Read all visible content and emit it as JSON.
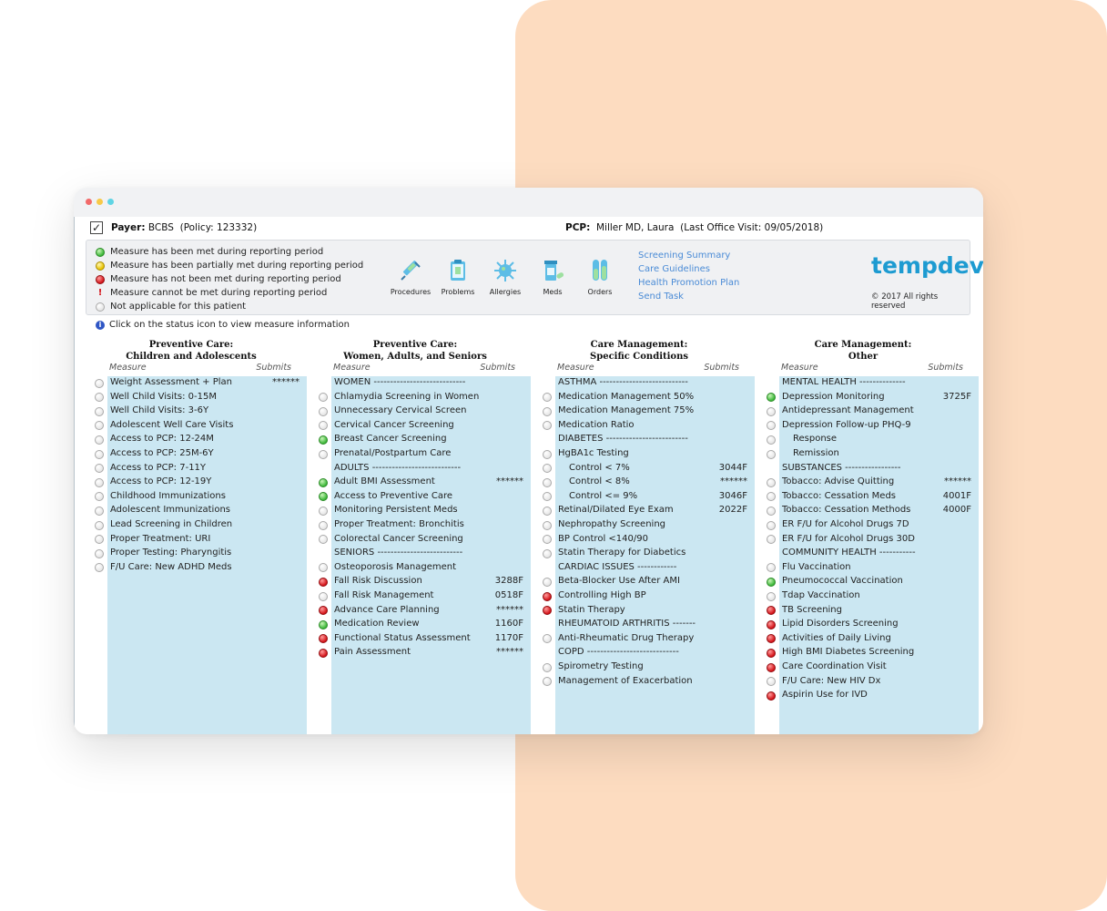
{
  "header": {
    "payer_label": "Payer:",
    "payer_value": "BCBS",
    "policy": "(Policy: 123332)",
    "pcp_label": "PCP:",
    "pcp_value": "Miller MD, Laura",
    "last_visit": "(Last Office Visit: 09/05/2018)"
  },
  "legend": [
    {
      "status": "met",
      "text": "Measure has been met during reporting period"
    },
    {
      "status": "partial",
      "text": "Measure has been partially met during reporting period"
    },
    {
      "status": "notmet",
      "text": "Measure has not been met during reporting period"
    },
    {
      "status": "cannot",
      "text": "Measure cannot be met during reporting period"
    },
    {
      "status": "na",
      "text": "Not applicable for this patient"
    }
  ],
  "tools": [
    {
      "label": "Procedures",
      "icon": "syringe-icon"
    },
    {
      "label": "Problems",
      "icon": "clipboard-icon"
    },
    {
      "label": "Allergies",
      "icon": "virus-icon"
    },
    {
      "label": "Meds",
      "icon": "pill-bottle-icon"
    },
    {
      "label": "Orders",
      "icon": "test-tubes-icon"
    }
  ],
  "links": [
    "Screening Summary",
    "Care Guidelines",
    "Health Promotion Plan",
    "Send Task"
  ],
  "brand": {
    "name": "tempdev",
    "copyright": "© 2017 All rights reserved"
  },
  "hint": "Click on the status icon to view measure information",
  "columns_header": {
    "measure": "Measure",
    "submits": "Submits"
  },
  "colors": {
    "accent_list": "#cbe7f2",
    "link": "#4a8bd6",
    "brand": "#1d9bd1",
    "peach": "#fddcc0"
  },
  "columns": [
    {
      "title1": "Preventive Care:",
      "title2": "Children and Adolescents",
      "rows": [
        {
          "status": "n",
          "label": "Weight Assessment + Plan",
          "submits": "******"
        },
        {
          "status": "n",
          "label": "Well Child Visits: 0-15M",
          "submits": ""
        },
        {
          "status": "n",
          "label": "Well Child Visits: 3-6Y",
          "submits": ""
        },
        {
          "status": "n",
          "label": "Adolescent Well Care Visits",
          "submits": ""
        },
        {
          "status": "n",
          "label": "Access to PCP: 12-24M",
          "submits": ""
        },
        {
          "status": "n",
          "label": "Access to PCP: 25M-6Y",
          "submits": ""
        },
        {
          "status": "n",
          "label": "Access to PCP: 7-11Y",
          "submits": ""
        },
        {
          "status": "n",
          "label": "Access to PCP: 12-19Y",
          "submits": ""
        },
        {
          "status": "n",
          "label": "Childhood Immunizations",
          "submits": ""
        },
        {
          "status": "n",
          "label": "Adolescent Immunizations",
          "submits": ""
        },
        {
          "status": "n",
          "label": "Lead Screening in Children",
          "submits": ""
        },
        {
          "status": "n",
          "label": "Proper Treatment: URI",
          "submits": ""
        },
        {
          "status": "n",
          "label": "Proper Testing: Pharyngitis",
          "submits": ""
        },
        {
          "status": "n",
          "label": "F/U Care: New ADHD Meds",
          "submits": ""
        }
      ]
    },
    {
      "title1": "Preventive Care:",
      "title2": "Women, Adults, and Seniors",
      "rows": [
        {
          "status": "",
          "label": "WOMEN ----------------------------",
          "submits": ""
        },
        {
          "status": "n",
          "label": "Chlamydia Screening in Women",
          "submits": ""
        },
        {
          "status": "n",
          "label": "Unnecessary Cervical Screen",
          "submits": ""
        },
        {
          "status": "n",
          "label": "Cervical Cancer Screening",
          "submits": ""
        },
        {
          "status": "g",
          "label": "Breast Cancer Screening",
          "submits": ""
        },
        {
          "status": "n",
          "label": "Prenatal/Postpartum Care",
          "submits": ""
        },
        {
          "status": "",
          "label": "ADULTS ---------------------------",
          "submits": ""
        },
        {
          "status": "g",
          "label": "Adult BMI Assessment",
          "submits": "******"
        },
        {
          "status": "g",
          "label": "Access to Preventive Care",
          "submits": ""
        },
        {
          "status": "n",
          "label": "Monitoring Persistent Meds",
          "submits": ""
        },
        {
          "status": "n",
          "label": "Proper Treatment: Bronchitis",
          "submits": ""
        },
        {
          "status": "n",
          "label": "Colorectal Cancer Screening",
          "submits": ""
        },
        {
          "status": "",
          "label": "SENIORS --------------------------",
          "submits": ""
        },
        {
          "status": "n",
          "label": "Osteoporosis Management",
          "submits": ""
        },
        {
          "status": "r",
          "label": "Fall Risk Discussion",
          "submits": "3288F"
        },
        {
          "status": "n",
          "label": "Fall Risk Management",
          "submits": "0518F"
        },
        {
          "status": "r",
          "label": "Advance Care Planning",
          "submits": "******"
        },
        {
          "status": "g",
          "label": "Medication Review",
          "submits": "1160F"
        },
        {
          "status": "r",
          "label": "Functional Status Assessment",
          "submits": "1170F"
        },
        {
          "status": "r",
          "label": "Pain Assessment",
          "submits": "******"
        }
      ]
    },
    {
      "title1": "Care Management:",
      "title2": "Specific Conditions",
      "rows": [
        {
          "status": "",
          "label": "ASTHMA ---------------------------",
          "submits": ""
        },
        {
          "status": "n",
          "label": "Medication Management 50%",
          "submits": ""
        },
        {
          "status": "n",
          "label": "Medication Management 75%",
          "submits": ""
        },
        {
          "status": "n",
          "label": "Medication Ratio",
          "submits": ""
        },
        {
          "status": "",
          "label": "DIABETES -------------------------",
          "submits": ""
        },
        {
          "status": "n",
          "label": "HgBA1c Testing",
          "submits": ""
        },
        {
          "status": "n",
          "label": "Control < 7%",
          "submits": "3044F",
          "indent": true
        },
        {
          "status": "n",
          "label": "Control < 8%",
          "submits": "******",
          "indent": true
        },
        {
          "status": "n",
          "label": "Control <= 9%",
          "submits": "3046F",
          "indent": true
        },
        {
          "status": "n",
          "label": "Retinal/Dilated Eye Exam",
          "submits": "2022F"
        },
        {
          "status": "n",
          "label": "Nephropathy Screening",
          "submits": ""
        },
        {
          "status": "n",
          "label": "BP Control <140/90",
          "submits": ""
        },
        {
          "status": "n",
          "label": "Statin Therapy for Diabetics",
          "submits": ""
        },
        {
          "status": "",
          "label": "CARDIAC ISSUES ------------",
          "submits": ""
        },
        {
          "status": "n",
          "label": "Beta-Blocker Use After AMI",
          "submits": ""
        },
        {
          "status": "r",
          "label": "Controlling High BP",
          "submits": ""
        },
        {
          "status": "r",
          "label": "Statin Therapy",
          "submits": ""
        },
        {
          "status": "",
          "label": "RHEUMATOID ARTHRITIS -------",
          "submits": ""
        },
        {
          "status": "n",
          "label": "Anti-Rheumatic Drug Therapy",
          "submits": ""
        },
        {
          "status": "",
          "label": "COPD ----------------------------",
          "submits": ""
        },
        {
          "status": "n",
          "label": "Spirometry Testing",
          "submits": ""
        },
        {
          "status": "n",
          "label": "Management of Exacerbation",
          "submits": ""
        }
      ]
    },
    {
      "title1": "Care Management:",
      "title2": "Other",
      "rows": [
        {
          "status": "",
          "label": "MENTAL HEALTH --------------",
          "submits": ""
        },
        {
          "status": "g",
          "label": "Depression Monitoring",
          "submits": "3725F"
        },
        {
          "status": "n",
          "label": "Antidepressant Management",
          "submits": ""
        },
        {
          "status": "n",
          "label": "Depression Follow-up PHQ-9",
          "submits": ""
        },
        {
          "status": "n",
          "label": "Response",
          "submits": "",
          "indent": true
        },
        {
          "status": "n",
          "label": "Remission",
          "submits": "",
          "indent": true
        },
        {
          "status": "",
          "label": "SUBSTANCES -----------------",
          "submits": ""
        },
        {
          "status": "n",
          "label": "Tobacco: Advise Quitting",
          "submits": "******"
        },
        {
          "status": "n",
          "label": "Tobacco: Cessation Meds",
          "submits": "4001F"
        },
        {
          "status": "n",
          "label": "Tobacco: Cessation Methods",
          "submits": "4000F"
        },
        {
          "status": "n",
          "label": "ER F/U for Alcohol Drugs 7D",
          "submits": ""
        },
        {
          "status": "n",
          "label": "ER F/U for Alcohol Drugs 30D",
          "submits": ""
        },
        {
          "status": "",
          "label": "COMMUNITY HEALTH -----------",
          "submits": ""
        },
        {
          "status": "n",
          "label": "Flu Vaccination",
          "submits": ""
        },
        {
          "status": "g",
          "label": "Pneumococcal Vaccination",
          "submits": ""
        },
        {
          "status": "n",
          "label": "Tdap Vaccination",
          "submits": ""
        },
        {
          "status": "r",
          "label": "TB Screening",
          "submits": ""
        },
        {
          "status": "r",
          "label": "Lipid Disorders Screening",
          "submits": ""
        },
        {
          "status": "r",
          "label": "Activities of Daily Living",
          "submits": ""
        },
        {
          "status": "r",
          "label": "High BMI Diabetes Screening",
          "submits": ""
        },
        {
          "status": "r",
          "label": "Care Coordination Visit",
          "submits": ""
        },
        {
          "status": "n",
          "label": "F/U Care: New HIV Dx",
          "submits": ""
        },
        {
          "status": "r",
          "label": "Aspirin Use for IVD",
          "submits": ""
        }
      ]
    }
  ]
}
